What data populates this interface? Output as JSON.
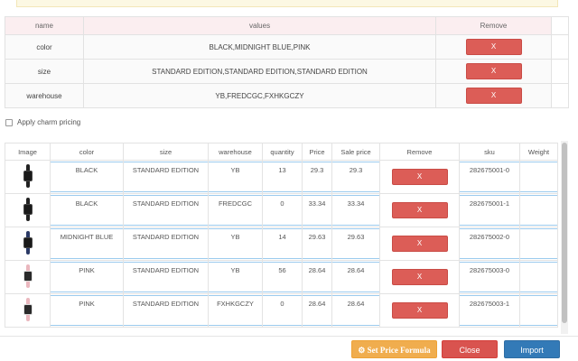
{
  "attributes": {
    "headers": {
      "name": "name",
      "values": "values",
      "remove": "Remove"
    },
    "rows": [
      {
        "name": "color",
        "values": "BLACK,MIDNIGHT BLUE,PINK",
        "remove": "X"
      },
      {
        "name": "size",
        "values": "STANDARD EDITION,STANDARD EDITION,STANDARD EDITION",
        "remove": "X"
      },
      {
        "name": "warehouse",
        "values": "YB,FREDCGC,FXHKGCZY",
        "remove": "X"
      }
    ]
  },
  "charm": {
    "label": "Apply charm pricing",
    "checked": false
  },
  "variants": {
    "headers": {
      "image": "Image",
      "color": "color",
      "size": "size",
      "warehouse": "warehouse",
      "quantity": "quantity",
      "price": "Price",
      "sale_price": "Sale price",
      "remove": "Remove",
      "sku": "sku",
      "weight": "Weight"
    },
    "rows": [
      {
        "thumb": "black-band-icon",
        "color": "BLACK",
        "size": "STANDARD EDITION",
        "warehouse": "YB",
        "quantity": "13",
        "price": "29.3",
        "sale_price": "29.3",
        "remove": "X",
        "sku": "282675001-0",
        "weight": ""
      },
      {
        "thumb": "black-band-icon",
        "color": "BLACK",
        "size": "STANDARD EDITION",
        "warehouse": "FREDCGC",
        "quantity": "0",
        "price": "33.34",
        "sale_price": "33.34",
        "remove": "X",
        "sku": "282675001-1",
        "weight": ""
      },
      {
        "thumb": "blue-band-icon",
        "color": "MIDNIGHT BLUE",
        "size": "STANDARD EDITION",
        "warehouse": "YB",
        "quantity": "14",
        "price": "29.63",
        "sale_price": "29.63",
        "remove": "X",
        "sku": "282675002-0",
        "weight": ""
      },
      {
        "thumb": "pink-band-icon",
        "color": "PINK",
        "size": "STANDARD EDITION",
        "warehouse": "YB",
        "quantity": "56",
        "price": "28.64",
        "sale_price": "28.64",
        "remove": "X",
        "sku": "282675003-0",
        "weight": ""
      },
      {
        "thumb": "pink-band-icon",
        "color": "PINK",
        "size": "STANDARD EDITION",
        "warehouse": "FXHKGCZY",
        "quantity": "0",
        "price": "28.64",
        "sale_price": "28.64",
        "remove": "X",
        "sku": "282675003-1",
        "weight": ""
      }
    ]
  },
  "footer": {
    "set_price_formula": "Set Price Formula",
    "close": "Close",
    "import": "Import"
  },
  "icons": {
    "formula": "gears-icon"
  },
  "colors": {
    "danger": "#d9534f",
    "warning": "#f0ad4e",
    "primary": "#337ab7",
    "focus_border": "#9ccbee"
  }
}
